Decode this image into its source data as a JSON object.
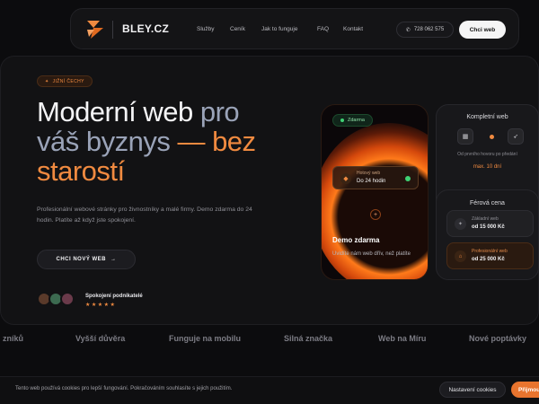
{
  "nav": {
    "brand": "BLEY.CZ",
    "links": [
      "Služby",
      "Ceník",
      "Jak to funguje",
      "FAQ",
      "Kontakt"
    ],
    "phone": "728 062 575",
    "cta": "Chci web"
  },
  "hero": {
    "badge": "JIŽNÍ ČECHY",
    "headline": {
      "part1": "Moderní web",
      "part2": " pro",
      "part3": "váš byznys",
      "part4": " — bez",
      "part5": "starostí"
    },
    "subtext": "Profesionální webové stránky pro živnostníky a malé firmy. Demo zdarma do 24 hodin. Platíte až když jste spokojení.",
    "cta": "CHCI NOVÝ WEB",
    "proof_label": "Spokojení podnikatelé",
    "stars": "★★★★★"
  },
  "phone_card": {
    "status": "Zdarma",
    "ready_label": "Hotový web",
    "ready_value": "Do 24 hodin",
    "demo_title": "Demo zdarma",
    "demo_text": "Uvidíte nám web dřív, než platíte"
  },
  "card_complete": {
    "title": "Kompletní web",
    "note": "Od prvního hovoru po předání",
    "time": "max. 10 dní"
  },
  "card_price": {
    "title": "Férová cena",
    "items": [
      {
        "label": "Základní web",
        "value": "od 15 000 Kč"
      },
      {
        "label": "Profesionální web",
        "value": "od 25 000 Kč"
      }
    ]
  },
  "ticker": [
    "zníků",
    "Vyšší důvěra",
    "Funguje na mobilu",
    "Silná značka",
    "Web na Míru",
    "Nové poptávky"
  ],
  "cookie": {
    "text": "Tento web používá cookies pro lepší fungování. Pokračováním souhlasíte s jejich použitím.",
    "settings": "Nastavení cookies",
    "accept": "Přijmout"
  },
  "colors": {
    "accent": "#f08a40",
    "muted_headline": "#9aa3b8",
    "background": "#0c0c0e",
    "success": "#3fd174"
  }
}
